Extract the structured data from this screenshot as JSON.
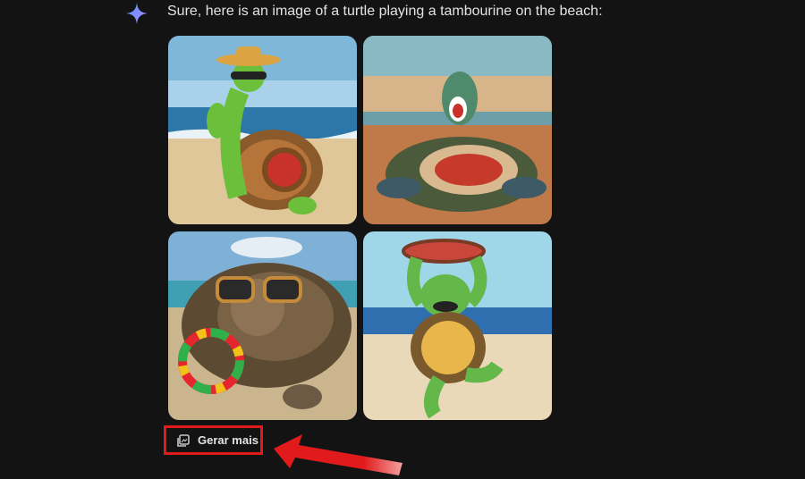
{
  "response": {
    "text": "Sure, here is an image of a turtle playing a tambourine on the beach:"
  },
  "images": [
    {
      "subject": "cartoon turtle with straw hat and sunglasses holding tambourine"
    },
    {
      "subject": "sea turtle with open mouth holding tambourine on sand"
    },
    {
      "subject": "tortoise wearing sunglasses with colorful tambourine"
    },
    {
      "subject": "dancing cartoon turtle holding tambourine overhead"
    }
  ],
  "actions": {
    "generate_more_label": "Gerar mais"
  },
  "colors": {
    "background": "#131314",
    "text": "#e3e3e3",
    "highlight": "#e11b1b"
  },
  "icons": {
    "assistant": "sparkle-icon",
    "generate_more": "image-stack-icon"
  }
}
